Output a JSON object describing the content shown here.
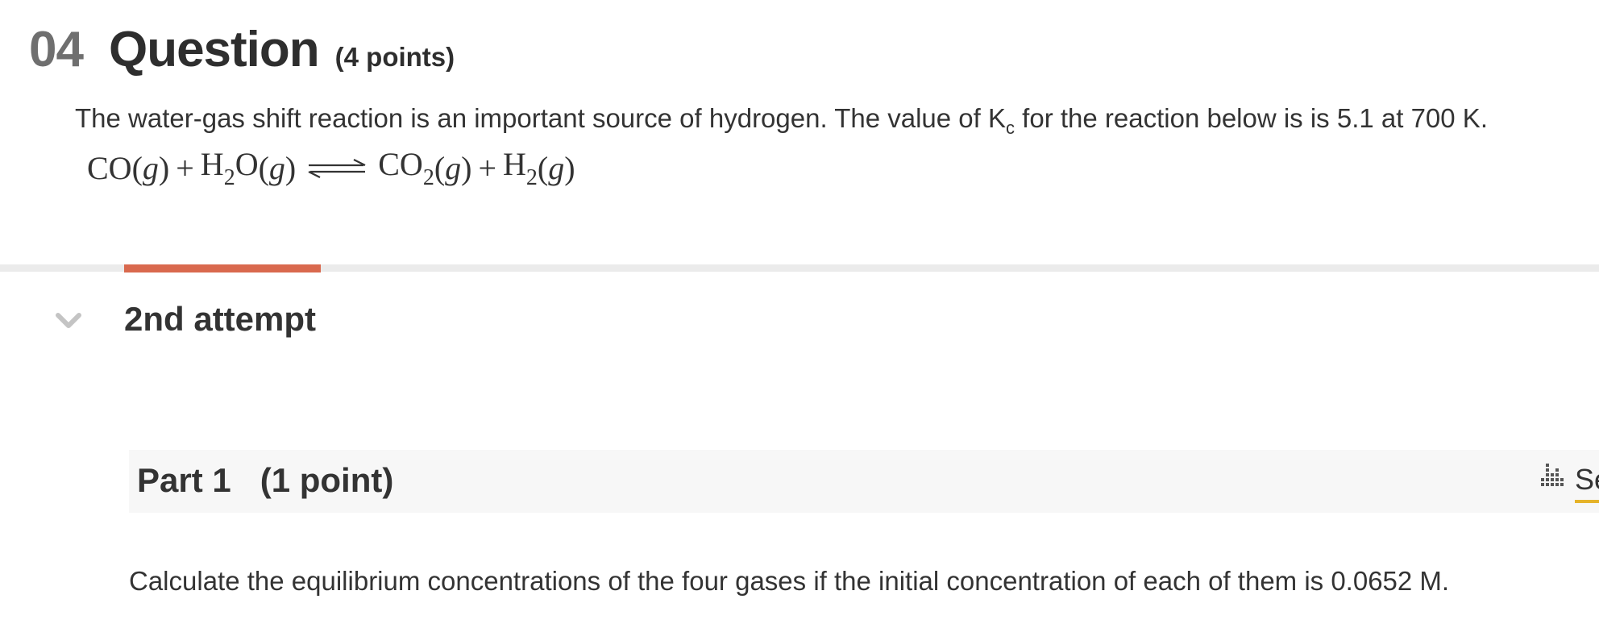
{
  "question": {
    "number": "04",
    "title": "Question",
    "points": "(4 points)",
    "text_before": "The water-gas shift reaction is an important source of hydrogen. The value of K",
    "text_sub": "c",
    "text_after": " for the reaction below is is 5.1 at 700 K."
  },
  "equation": {
    "r1": "CO",
    "g": "g",
    "plus": "+",
    "h": "H",
    "two": "2",
    "o": "O",
    "p1": "CO"
  },
  "attempt": {
    "title": "2nd attempt"
  },
  "part": {
    "label": "Part 1",
    "points": "(1 point)",
    "side_text": "Se",
    "question": "Calculate the equilibrium concentrations of the four gases if the initial concentration of each of them is 0.0652 M."
  },
  "colors": {
    "active_tab": "#d9694e",
    "link_underline": "#e5b32a",
    "part_bar": "#f7f7f7"
  },
  "icons": {
    "collapse": "chevron-down-icon",
    "stats": "bar-chart-icon",
    "equilibrium": "equilibrium-arrows-icon"
  }
}
